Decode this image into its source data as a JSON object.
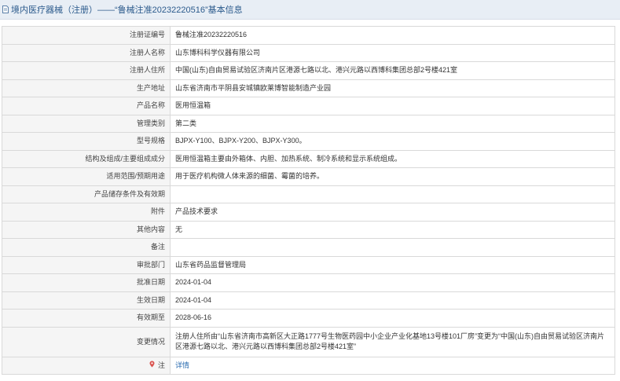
{
  "header": {
    "title": "境内医疗器械（注册）——“鲁械注准20232220516”基本信息"
  },
  "rows": [
    {
      "label": "注册证编号",
      "value": "鲁械注准20232220516"
    },
    {
      "label": "注册人名称",
      "value": "山东博科科学仪器有限公司"
    },
    {
      "label": "注册人住所",
      "value": "中国(山东)自由贸易试验区济南片区港源七路以北、港兴元路以西博科集团总部2号楼421室"
    },
    {
      "label": "生产地址",
      "value": "山东省济南市平阴县安城镇欧莱博智能制造产业园"
    },
    {
      "label": "产品名称",
      "value": "医用恒温箱"
    },
    {
      "label": "管理类别",
      "value": "第二类"
    },
    {
      "label": "型号规格",
      "value": "BJPX-Y100、BJPX-Y200、BJPX-Y300。"
    },
    {
      "label": "结构及组成/主要组成成分",
      "value": "医用恒温箱主要由外箱体、内胆、加热系统、制冷系统和显示系统组成。"
    },
    {
      "label": "适用范围/预期用途",
      "value": "用于医疗机构微人体来源的细菌、霉菌的培养。"
    },
    {
      "label": "产品储存条件及有效期",
      "value": ""
    },
    {
      "label": "附件",
      "value": "产品技术要求"
    },
    {
      "label": "其他内容",
      "value": "无"
    },
    {
      "label": "备注",
      "value": ""
    },
    {
      "label": "审批部门",
      "value": "山东省药品监督管理局"
    },
    {
      "label": "批准日期",
      "value": "2024-01-04"
    },
    {
      "label": "生效日期",
      "value": "2024-01-04"
    },
    {
      "label": "有效期至",
      "value": "2028-06-16"
    },
    {
      "label": "变更情况",
      "value": "注册人住所由“山东省济南市高新区大正路1777号生物医药园中小企业产业化基地13号楼101厂房”变更为“中国(山东)自由贸易试验区济南片区港源七路以北、港兴元路以西博科集团总部2号楼421室”"
    }
  ],
  "note": {
    "icon": "location-pin-icon",
    "label": "注",
    "link_text": "详情"
  },
  "colors": {
    "header_bg": "#e8eef5",
    "title_text": "#2b5a8c",
    "label_bg": "#f5f5f5",
    "link": "#2b6cb0"
  }
}
